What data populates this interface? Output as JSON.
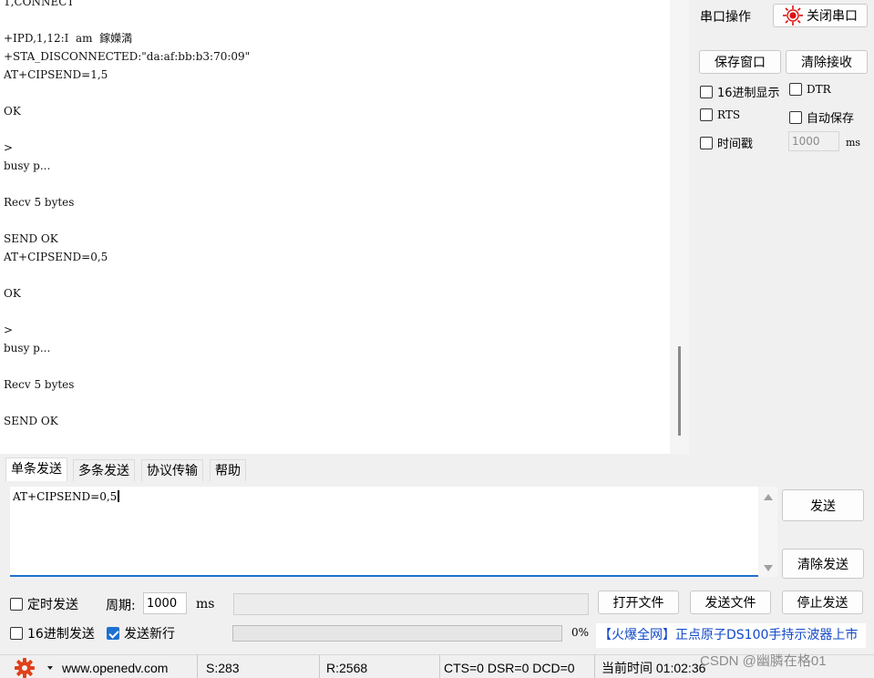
{
  "receive": {
    "lines": [
      "1,CONNECT",
      "",
      "+IPD,1,12:I  am  鎵嬫満",
      "+STA_DISCONNECTED:\"da:af:bb:b3:70:09\"",
      "AT+CIPSEND=1,5",
      "",
      "OK",
      "",
      ">",
      "busy p...",
      "",
      "Recv 5 bytes",
      "",
      "SEND OK",
      "AT+CIPSEND=0,5",
      "",
      "OK",
      "",
      ">",
      "busy p...",
      "",
      "Recv 5 bytes",
      "",
      "SEND OK"
    ]
  },
  "right_panel": {
    "port_label": "串口操作",
    "close_port_button": "关闭串口",
    "save_window_button": "保存窗口",
    "clear_receive_button": "清除接收",
    "hex_display": "16进制显示",
    "dtr": "DTR",
    "rts": "RTS",
    "auto_save": "自动保存",
    "timestamp": "时间戳",
    "timestamp_value": "1000",
    "timestamp_unit": "ms"
  },
  "tabs": [
    "单条发送",
    "多条发送",
    "协议传输",
    "帮助"
  ],
  "send": {
    "text": "AT+CIPSEND=0,5",
    "send_button": "发送",
    "clear_send_button": "清除发送",
    "timed_send": "定时发送",
    "period_label": "周期:",
    "period_value": "1000",
    "period_unit": "ms",
    "open_file_button": "打开文件",
    "send_file_button": "发送文件",
    "stop_send_button": "停止发送",
    "hex_send": "16进制发送",
    "send_newline": "发送新行",
    "progress_percent": "0%",
    "progress_value": 0,
    "promo": "【火爆全网】正点原子DS100手持示波器上市"
  },
  "status_bar": {
    "url": "www.openedv.com",
    "sent": "S:283",
    "received": "R:2568",
    "signals": "CTS=0 DSR=0 DCD=0",
    "time": "当前时间 01:02:36"
  },
  "watermark": "CSDN @幽膦在格01",
  "colors": {
    "accent": "#1e6fd0",
    "promo_blue": "#1248c8",
    "record_red": "#e01010"
  }
}
